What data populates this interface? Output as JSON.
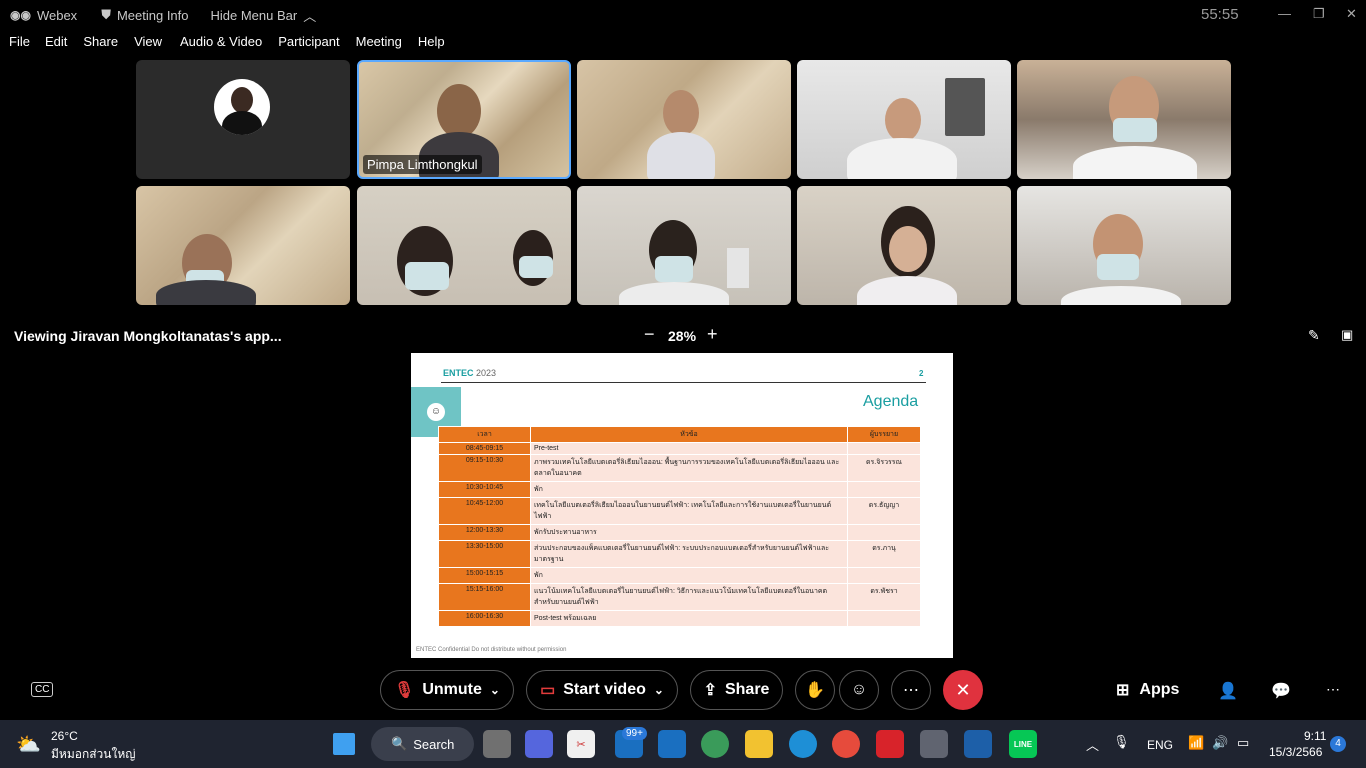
{
  "titlebar": {
    "app": "Webex",
    "meeting_info": "Meeting Info",
    "hide_menu": "Hide Menu Bar",
    "timer": "55:55"
  },
  "menu": [
    "File",
    "Edit",
    "Share",
    "View",
    "Audio & Video",
    "Participant",
    "Meeting",
    "Help"
  ],
  "participants": {
    "highlighted_name": "Pimpa Limthongkul"
  },
  "view": {
    "viewing": "Viewing Jiravan Mongkoltanatas's app...",
    "zoom": "28%",
    "minus": "−",
    "plus": "+"
  },
  "slide": {
    "brand": "ENTEC",
    "year": "2023",
    "page": "2",
    "title": "Agenda",
    "headers": [
      "เวลา",
      "หัวข้อ",
      "ผู้บรรยาย"
    ],
    "rows": [
      {
        "time": "08:45-09:15",
        "topic": "Pre-test",
        "speaker": ""
      },
      {
        "time": "09:15-10:30",
        "topic": "ภาพรวมเทคโนโลยีแบตเตอรี่ลิเธียมไอออน: พื้นฐานการรวมของเทคโนโลยีแบตเตอรี่ลิเธียมไอออน และตลาดในอนาคต",
        "speaker": "ดร.จิรวรรณ"
      },
      {
        "time": "10:30-10:45",
        "topic": "พัก",
        "speaker": ""
      },
      {
        "time": "10:45-12:00",
        "topic": "เทคโนโลยีแบตเตอรี่ลิเธียมไอออนในยานยนต์ไฟฟ้า: เทคโนโลยีและการใช้งานแบตเตอรี่ในยานยนต์ไฟฟ้า",
        "speaker": "ดร.ธัญญา"
      },
      {
        "time": "12:00-13:30",
        "topic": "พักรับประทานอาหาร",
        "speaker": ""
      },
      {
        "time": "13:30-15:00",
        "topic": "ส่วนประกอบของแพ็คแบตเตอรี่ในยานยนต์ไฟฟ้า: ระบบประกอบแบตเตอรี่สำหรับยานยนต์ไฟฟ้าและมาตรฐาน",
        "speaker": "ดร.ภานุ"
      },
      {
        "time": "15:00-15:15",
        "topic": "พัก",
        "speaker": ""
      },
      {
        "time": "15:15-16:00",
        "topic": "แนวโน้มเทคโนโลยีแบตเตอรี่ในยานยนต์ไฟฟ้า: วิธีการและแนวโน้มเทคโนโลยีแบตเตอรี่ในอนาคตสำหรับยานยนต์ไฟฟ้า",
        "speaker": "ดร.พัชรา"
      },
      {
        "time": "16:00-16:30",
        "topic": "Post-test พร้อมเฉลย",
        "speaker": ""
      }
    ],
    "footer": "ENTEC   Confidential   Do not distribute without permission"
  },
  "controls": {
    "unmute": "Unmute",
    "start_video": "Start video",
    "share": "Share",
    "more": "⋯",
    "apps": "Apps"
  },
  "taskbar": {
    "temp": "26°C",
    "weather": "มีหมอกส่วนใหญ่",
    "search": "Search",
    "badge_mail": "99+",
    "lang": "ENG",
    "time": "9:11",
    "date": "15/3/2566",
    "notif": "4"
  }
}
